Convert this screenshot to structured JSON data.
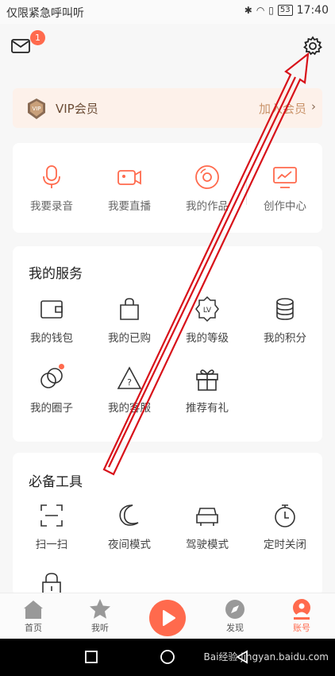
{
  "status_bar": {
    "carrier": "仅限紧急呼叫",
    "carrier_suffix": "听",
    "battery": "53",
    "time": "17:40"
  },
  "header": {
    "mail_badge": "1",
    "icons": {
      "mail": "mail-icon",
      "settings": "gear-icon"
    }
  },
  "vip": {
    "badge_text": "VIP",
    "title": "VIP会员",
    "action": "加入会员",
    "arrow": "›"
  },
  "quick_actions": [
    {
      "label": "我要录音",
      "icon": "microphone-icon"
    },
    {
      "label": "我要直播",
      "icon": "video-camera-icon"
    },
    {
      "label": "我的作品",
      "icon": "disc-icon"
    },
    {
      "label": "创作中心",
      "icon": "monitor-chart-icon"
    }
  ],
  "services": {
    "title": "我的服务",
    "items": [
      {
        "label": "我的钱包",
        "icon": "wallet-icon"
      },
      {
        "label": "我的已购",
        "icon": "shopping-bag-icon"
      },
      {
        "label": "我的等级",
        "icon": "level-badge-icon",
        "icon_text": "LV"
      },
      {
        "label": "我的积分",
        "icon": "coins-icon"
      },
      {
        "label": "我的圈子",
        "icon": "circles-icon"
      },
      {
        "label": "我的客服",
        "icon": "help-triangle-icon",
        "icon_text": "?"
      },
      {
        "label": "推荐有礼",
        "icon": "gift-icon"
      }
    ]
  },
  "tools": {
    "title": "必备工具",
    "items": [
      {
        "label": "扫一扫",
        "icon": "scan-icon"
      },
      {
        "label": "夜间模式",
        "icon": "moon-icon"
      },
      {
        "label": "驾驶模式",
        "icon": "car-icon"
      },
      {
        "label": "定时关闭",
        "icon": "timer-icon"
      },
      {
        "label": "",
        "icon": "lock-icon"
      }
    ]
  },
  "tab_bar": [
    {
      "label": "首页",
      "icon": "home-icon"
    },
    {
      "label": "我听",
      "icon": "star-icon"
    },
    {
      "label": "",
      "icon": "play-icon"
    },
    {
      "label": "发现",
      "icon": "compass-icon"
    },
    {
      "label": "账号",
      "icon": "account-icon",
      "active": true
    }
  ],
  "watermark": "Bai经验 jingyan.baidu.com",
  "colors": {
    "accent": "#ff6a4d",
    "annotation": "#d8121a",
    "vip_text": "#c9936a"
  }
}
